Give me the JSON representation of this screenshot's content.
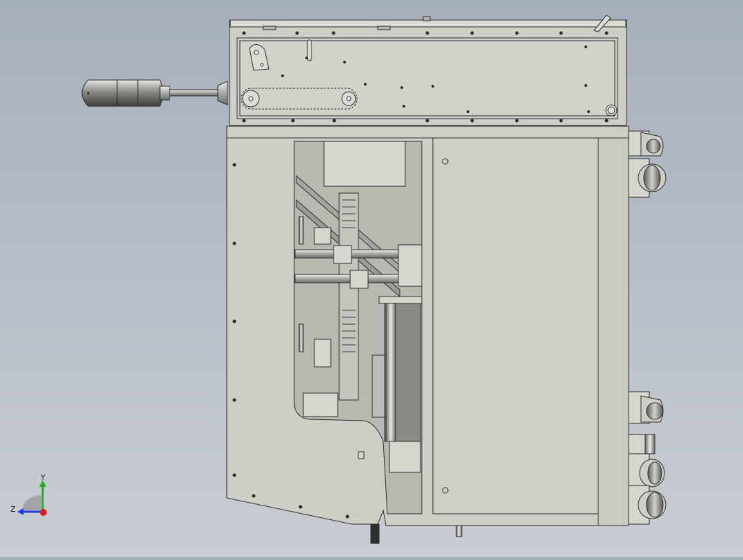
{
  "viewport": {
    "background_top": "#a6afbc",
    "background_bottom": "#c9cdd3",
    "model_fill": "#cfcec6",
    "model_edge": "#2a2a2a"
  },
  "triad": {
    "x_axis_color": "#d81e1e",
    "y_axis_color": "#22b022",
    "z_axis_color": "#1e3cd8",
    "y_label": "Y",
    "z_label": "Z"
  }
}
